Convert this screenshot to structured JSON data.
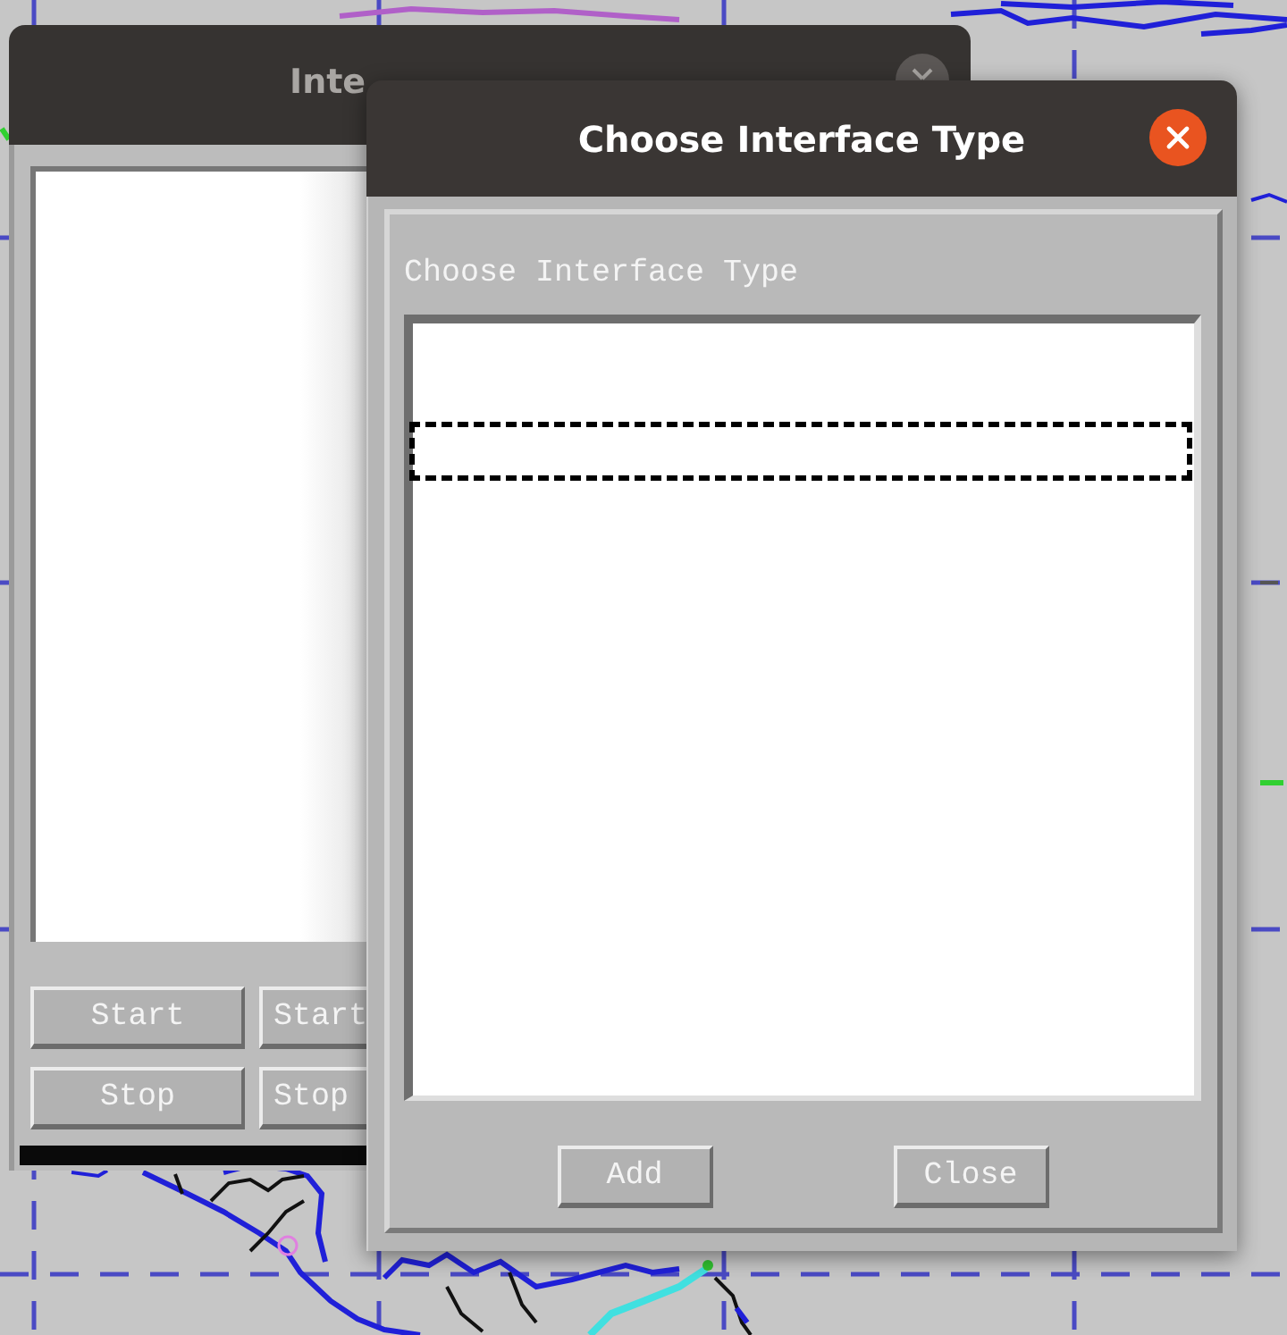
{
  "back_window": {
    "title": "Inte",
    "active": false,
    "button_rows": [
      [
        "Start",
        "Start"
      ],
      [
        "Stop",
        "Stop"
      ]
    ]
  },
  "dialog": {
    "title": "Choose Interface Type",
    "active": true,
    "prompt": "Choose Interface Type",
    "buttons": [
      "Add",
      "Close"
    ]
  }
}
